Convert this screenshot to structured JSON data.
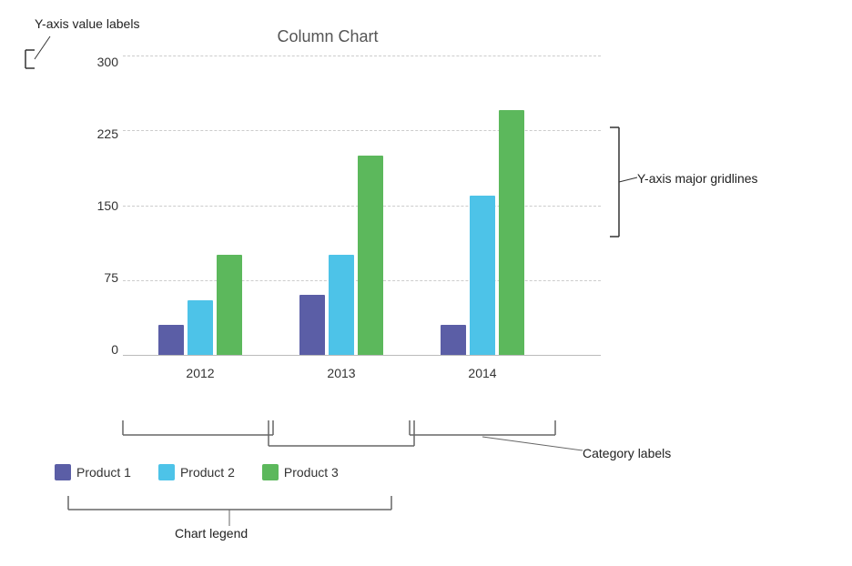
{
  "chart": {
    "title": "Column Chart",
    "yAxis": {
      "labels": [
        "300",
        "225",
        "150",
        "75",
        "0"
      ],
      "maxValue": 300,
      "annotation": "Y-axis value labels"
    },
    "gridlines": {
      "annotation": "Y-axis major gridlines",
      "values": [
        300,
        225,
        150,
        75,
        0
      ]
    },
    "categories": [
      "2012",
      "2013",
      "2014"
    ],
    "categoryAnnotation": "Category labels",
    "series": [
      {
        "name": "Product 1",
        "color": "#5b5ea6",
        "values": [
          30,
          60,
          30
        ]
      },
      {
        "name": "Product 2",
        "color": "#4dc3e8",
        "values": [
          55,
          100,
          160
        ]
      },
      {
        "name": "Product 3",
        "color": "#5cb85c",
        "values": [
          100,
          200,
          245
        ]
      }
    ],
    "legend": {
      "annotation": "Chart legend"
    }
  }
}
